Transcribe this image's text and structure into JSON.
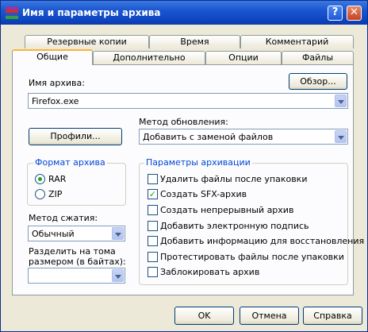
{
  "window": {
    "title": "Имя и параметры архива",
    "help_btn": "?",
    "close_btn": "✕"
  },
  "tabs_back": [
    "Резервные копии",
    "Время",
    "Комментарий"
  ],
  "tabs_front": [
    "Общие",
    "Дополнительно",
    "Опции",
    "Файлы"
  ],
  "archive_name": {
    "label": "Имя архива:",
    "value": "Firefox.exe",
    "browse": "Обзор..."
  },
  "profiles_button": "Профили...",
  "update_method": {
    "label": "Метод обновления:",
    "value": "Добавить с заменой файлов"
  },
  "format": {
    "title": "Формат архива",
    "options": [
      "RAR",
      "ZIP"
    ],
    "selected": "RAR"
  },
  "compression": {
    "label": "Метод сжатия:",
    "value": "Обычный"
  },
  "split": {
    "label_line1": "Разделить на тома",
    "label_line2": "размером (в байтах):",
    "value": ""
  },
  "archiving_params": {
    "title": "Параметры архивации",
    "options": [
      {
        "label": "Удалить файлы после упаковки",
        "checked": false
      },
      {
        "label": "Создать SFX-архив",
        "checked": true
      },
      {
        "label": "Создать непрерывный архив",
        "checked": false
      },
      {
        "label": "Добавить электронную подпись",
        "checked": false
      },
      {
        "label": "Добавить информацию для восстановления",
        "checked": false
      },
      {
        "label": "Протестировать файлы после упаковки",
        "checked": false
      },
      {
        "label": "Заблокировать архив",
        "checked": false
      }
    ]
  },
  "footer": {
    "ok": "OK",
    "cancel": "Отмена",
    "help": "Справка"
  },
  "checkmark": "✓"
}
